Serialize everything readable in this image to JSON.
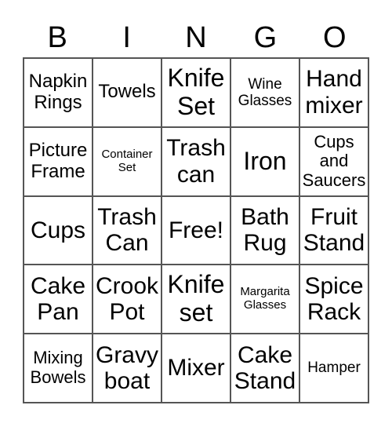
{
  "header": [
    "B",
    "I",
    "N",
    "G",
    "O"
  ],
  "cells": [
    [
      "Napkin Rings",
      "Towels",
      "Knife Set",
      "Wine Glasses",
      "Hand mixer"
    ],
    [
      "Picture Frame",
      "Container Set",
      "Trash can",
      "Iron",
      "Cups and Saucers"
    ],
    [
      "Cups",
      "Trash Can",
      "Free!",
      "Bath Rug",
      "Fruit Stand"
    ],
    [
      "Cake Pan",
      "Crook Pot",
      "Knife set",
      "Margarita Glasses",
      "Spice Rack"
    ],
    [
      "Mixing Bowels",
      "Gravy boat",
      "Mixer",
      "Cake Stand",
      "Hamper"
    ]
  ]
}
